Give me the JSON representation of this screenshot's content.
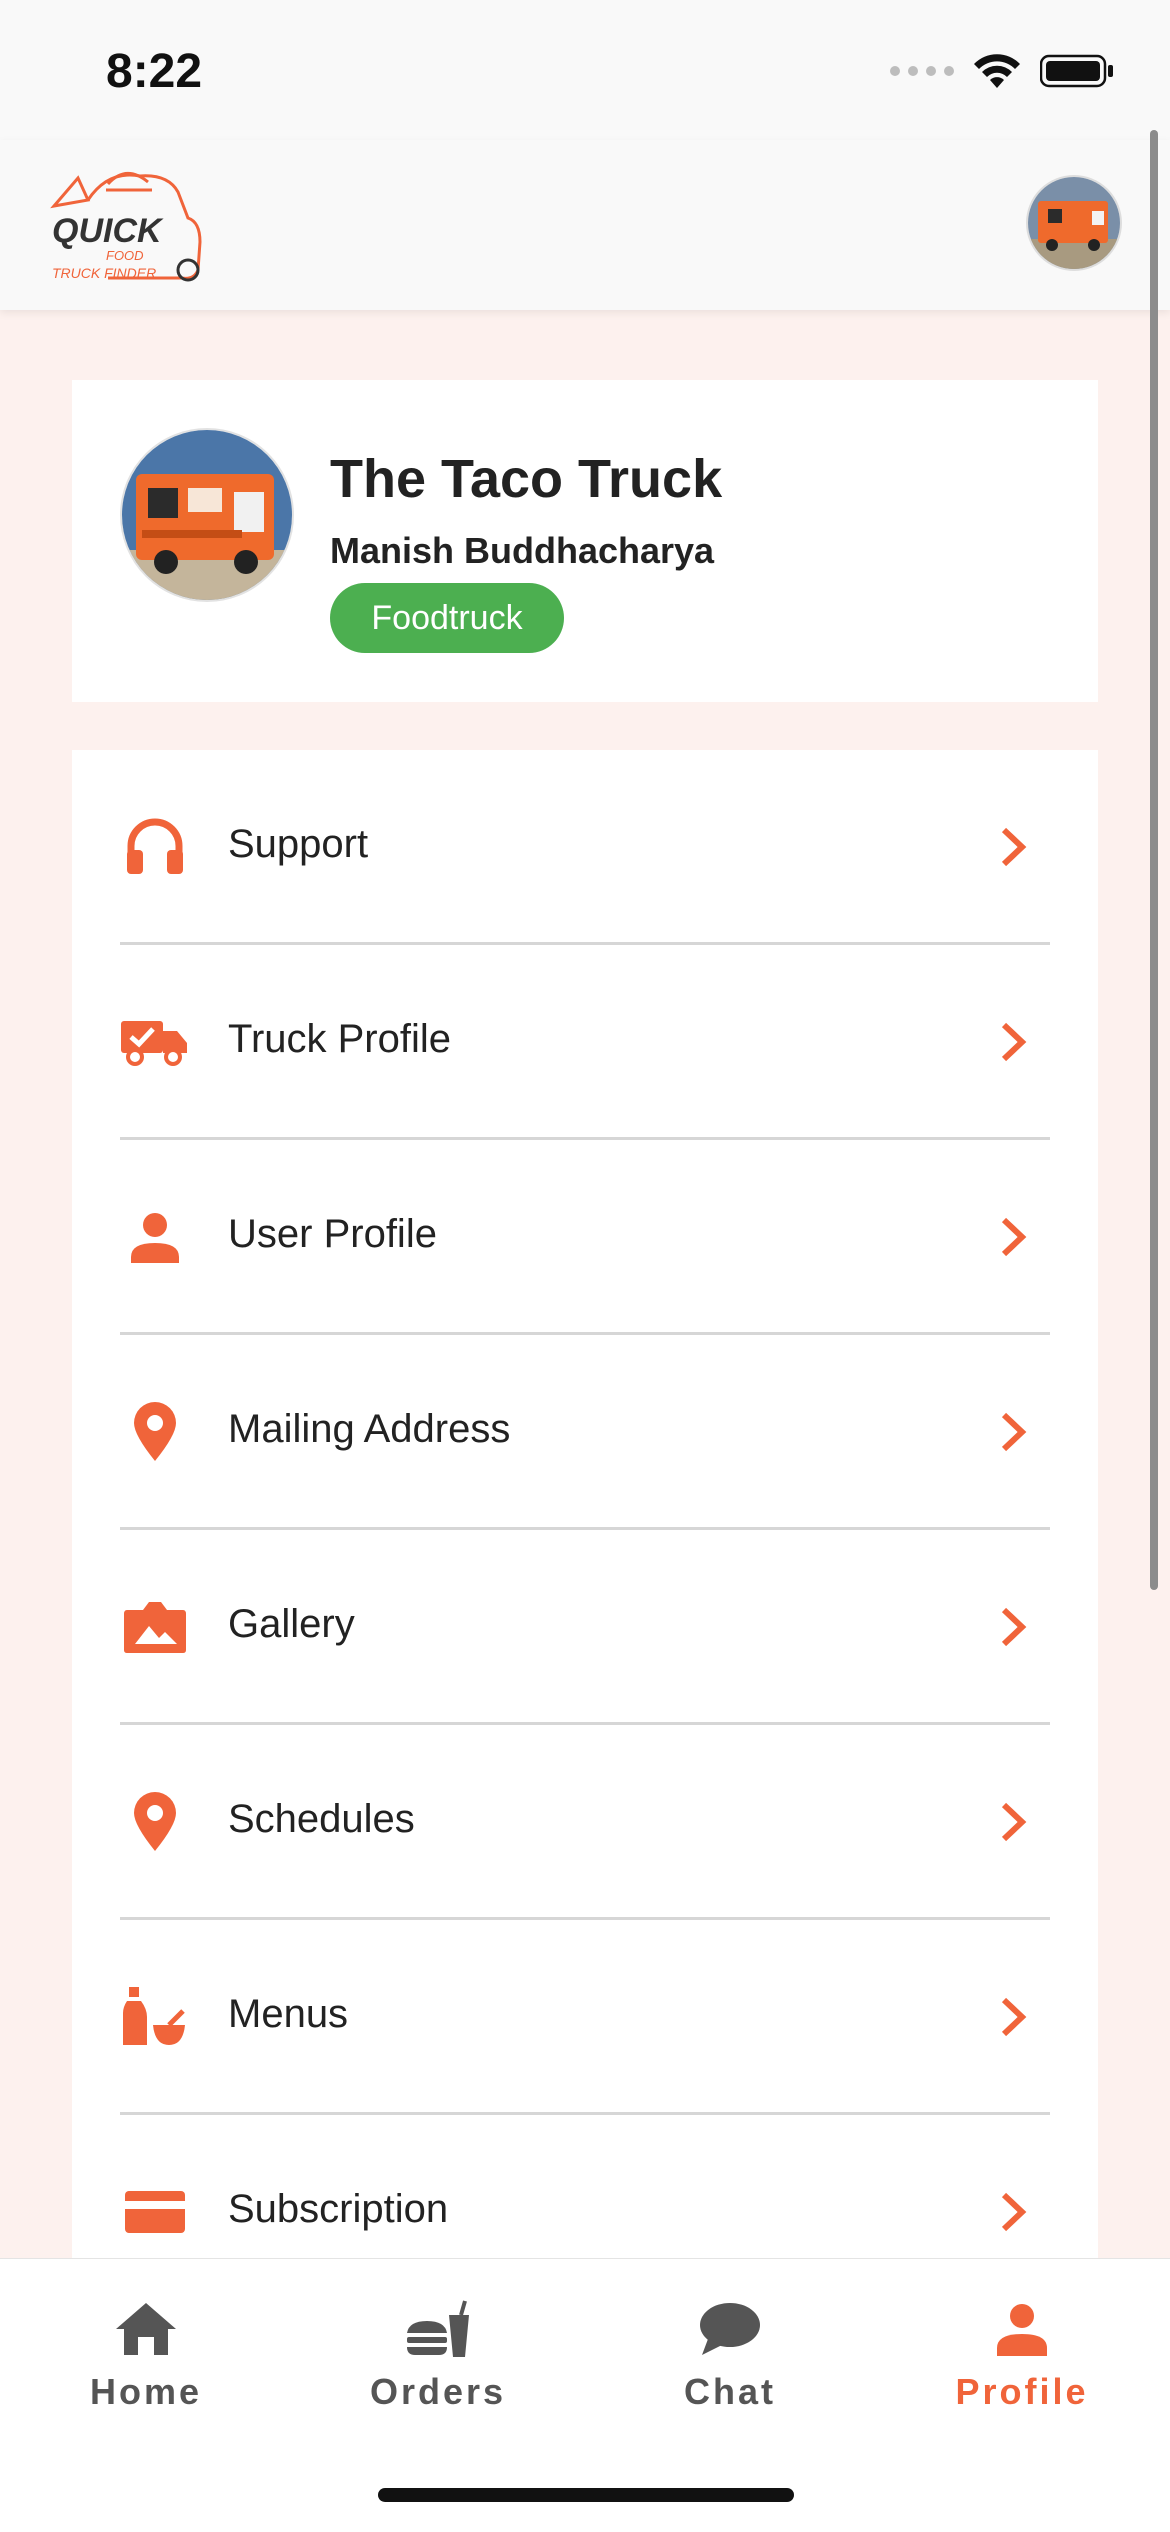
{
  "status_bar": {
    "time": "8:22"
  },
  "header": {
    "logo_primary": "QUICK",
    "logo_secondary": "FOOD",
    "logo_tertiary": "TRUCK FINDER"
  },
  "profile": {
    "name": "The Taco Truck",
    "owner": "Manish Buddhacharya",
    "badge": "Foodtruck"
  },
  "menu": {
    "items": [
      {
        "label": "Support",
        "icon": "headphones-icon"
      },
      {
        "label": "Truck Profile",
        "icon": "truck-check-icon"
      },
      {
        "label": "User Profile",
        "icon": "user-icon"
      },
      {
        "label": "Mailing Address",
        "icon": "location-pin-icon"
      },
      {
        "label": "Gallery",
        "icon": "camera-image-icon"
      },
      {
        "label": "Schedules",
        "icon": "location-pin-icon"
      },
      {
        "label": "Menus",
        "icon": "bottle-bowl-icon"
      },
      {
        "label": "Subscription",
        "icon": "credit-card-icon"
      }
    ]
  },
  "tabs": [
    {
      "label": "Home",
      "icon": "home-icon"
    },
    {
      "label": "Orders",
      "icon": "burger-drink-icon"
    },
    {
      "label": "Chat",
      "icon": "chat-bubble-icon"
    },
    {
      "label": "Profile",
      "icon": "user-icon",
      "active": true
    }
  ],
  "colors": {
    "accent": "#f0643a",
    "badge": "#4caf50",
    "tab_inactive": "#555555"
  }
}
